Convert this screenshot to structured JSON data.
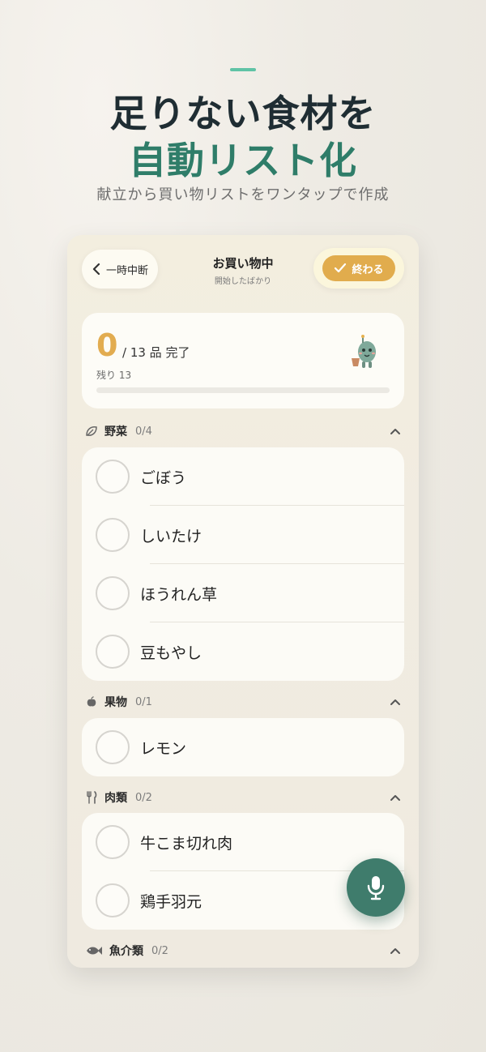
{
  "promo": {
    "headline_line1": "足りない食材を",
    "headline_line2": "自動リスト化",
    "subheadline": "献立から買い物リストをワンタップで作成"
  },
  "topbar": {
    "back_label": "一時中断",
    "title": "お買い物中",
    "subtitle": "開始したばかり",
    "finish_label": "終わる"
  },
  "progress": {
    "done": "0",
    "total_text": "/ 13 品 完了",
    "remaining_text": "残り 13",
    "fraction": 0
  },
  "categories": [
    {
      "name": "野菜",
      "count": "0/4",
      "icon": "leaf-icon",
      "items": [
        "ごぼう",
        "しいたけ",
        "ほうれん草",
        "豆もやし"
      ]
    },
    {
      "name": "果物",
      "count": "0/1",
      "icon": "apple-icon",
      "items": [
        "レモン"
      ]
    },
    {
      "name": "肉類",
      "count": "0/2",
      "icon": "fork-knife-icon",
      "items": [
        "牛こま切れ肉",
        "鶏手羽元"
      ]
    },
    {
      "name": "魚介類",
      "count": "0/2",
      "icon": "fish-icon",
      "items": []
    }
  ],
  "colors": {
    "accent_green": "#2f7d69",
    "accent_orange": "#e1ac4d",
    "mic_green": "#3f7c6c"
  }
}
